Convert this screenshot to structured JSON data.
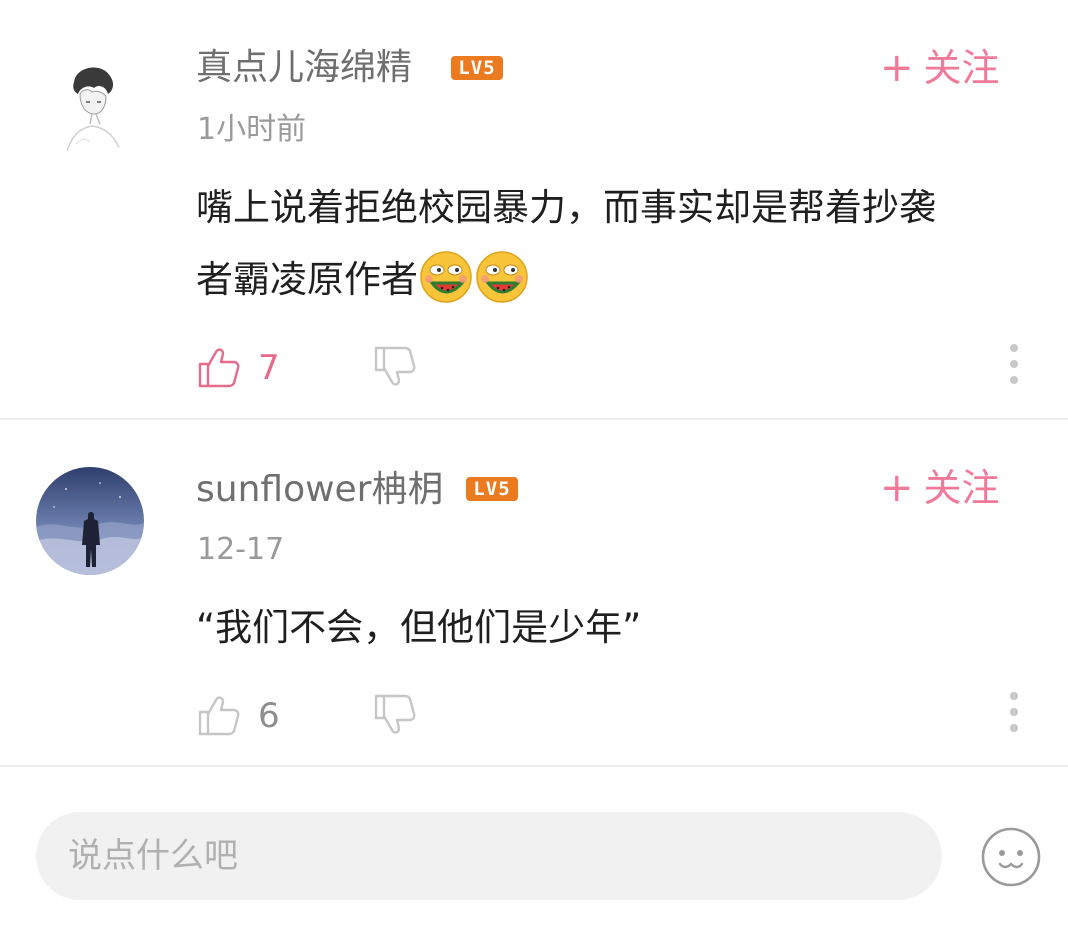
{
  "comments": [
    {
      "username": "真点儿海绵精",
      "level": "LV5",
      "follow_label": "关注",
      "time": "1小时前",
      "content_line1": "嘴上说着拒绝校园暴力，而事实却是帮着抄袭",
      "content_line2": "者霸凌原作者",
      "like_count": "7"
    },
    {
      "username": "sunflower柟枂",
      "level": "LV5",
      "follow_label": "关注",
      "time": "12-17",
      "content": "“我们不会，但他们是少年”",
      "like_count": "6"
    }
  ],
  "input_bar": {
    "placeholder": "说点什么吧"
  },
  "colors": {
    "accent_pink": "#f07a9a",
    "level_badge": "#ec7a1f",
    "like_active": "#e56b8b"
  }
}
